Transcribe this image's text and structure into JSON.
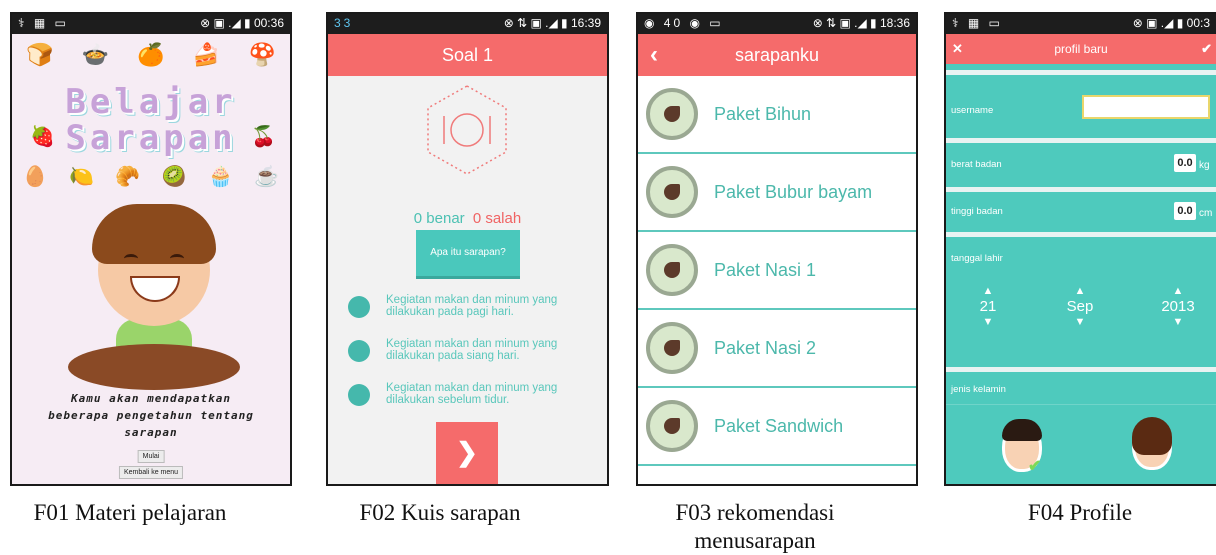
{
  "f01": {
    "status_left": "⚕ ▦ ▭",
    "status_right": "⊗ ▣ .◢ ▮ 00:36",
    "title_line1": "Belajar",
    "title_line2": "Sarapan",
    "description": "Kamu akan mendapatkan beberapa pengetahun tentang sarapan",
    "start_button": "Mulai",
    "back_button": "Kembali ke menu",
    "caption": "F01 Materi pelajaran"
  },
  "f02": {
    "status_left": "33",
    "status_right": "⊗ ⇅ ▣ .◢ ▮ 16:39",
    "header_title": "Soal 1",
    "correct_label": "0 benar",
    "wrong_label": "0 salah",
    "question": "Apa itu sarapan?",
    "options": [
      "Kegiatan makan dan minum yang dilakukan pada pagi hari.",
      "Kegiatan makan dan minum yang dilakukan pada siang hari.",
      "Kegiatan makan dan minum yang dilakukan sebelum tidur."
    ],
    "next_icon": "chevron-right-icon",
    "caption": "F02 Kuis sarapan"
  },
  "f03": {
    "status_left": "◉ 40 ◉ ▭",
    "status_right": "⊗ ⇅ ▣ .◢ ▮ 18:36",
    "header_title": "sarapanku",
    "items": [
      "Paket Bihun",
      "Paket Bubur bayam",
      "Paket Nasi 1",
      "Paket Nasi 2",
      "Paket Sandwich"
    ],
    "caption_line1": "F03 rekomendasi",
    "caption_line2": "menusarapan"
  },
  "f04": {
    "status_left": "⚕ ▦ ▭",
    "status_right": "⊗ ▣ .◢ ▮ 00:3",
    "header_title": "profil baru",
    "username_label": "username",
    "weight_label": "berat badan",
    "weight_value": "0.0",
    "weight_unit": "kg",
    "height_label": "tinggi badan",
    "height_value": "0.0",
    "height_unit": "cm",
    "birthdate_label": "tanggal lahir",
    "day": "21",
    "month": "Sep",
    "year": "2013",
    "gender_label": "jenis kelamin",
    "caption": "F04 Profile"
  },
  "colors": {
    "header_red": "#f56b6b",
    "teal": "#4ecabd",
    "teal_text": "#59c7bb"
  }
}
